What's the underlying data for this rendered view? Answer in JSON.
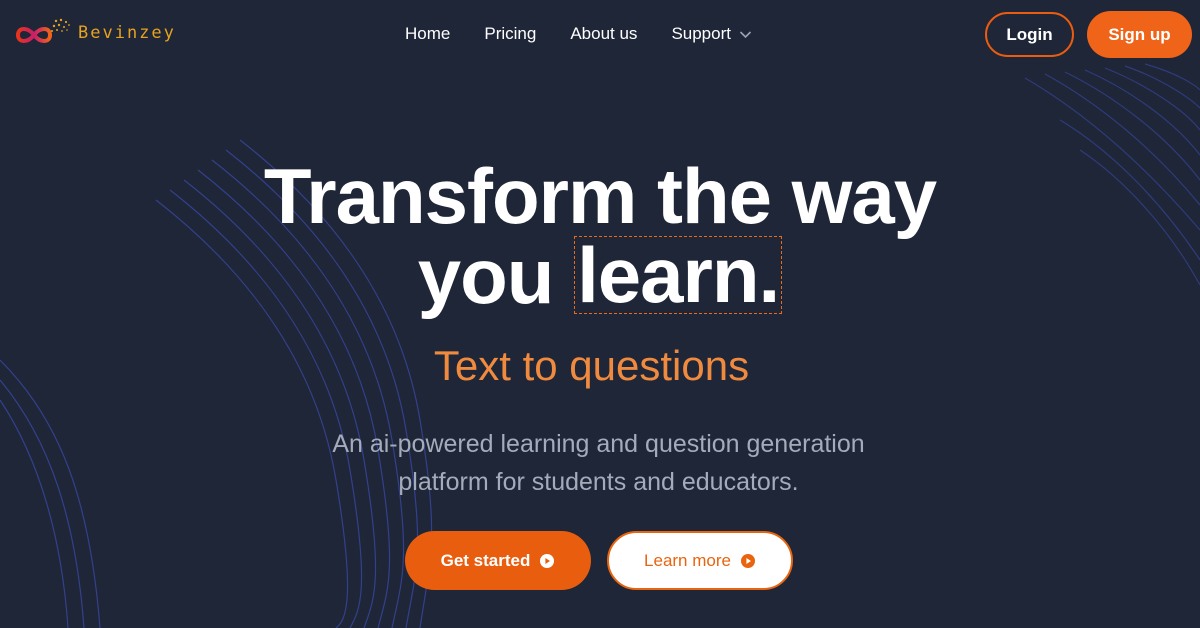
{
  "brand": {
    "name": "Bevinzey",
    "accent": "#f0641a",
    "logo_text_color": "#e8a21c"
  },
  "nav": {
    "items": [
      {
        "label": "Home"
      },
      {
        "label": "Pricing"
      },
      {
        "label": "About us"
      },
      {
        "label": "Support",
        "has_dropdown": true,
        "icon": "chevron-down-icon"
      }
    ]
  },
  "auth": {
    "login_label": "Login",
    "signup_label": "Sign up"
  },
  "hero": {
    "title_line1": "Transform the way",
    "title_line2_prefix": "you",
    "title_highlight": "learn.",
    "subtitle": "Text to questions",
    "description_line1": "An ai-powered learning and question generation",
    "description_line2": "platform for students and educators.",
    "cta_primary": "Get started",
    "cta_secondary": "Learn more",
    "cta_icon": "play-circle-icon"
  },
  "colors": {
    "background": "#1e2638",
    "subtitle": "#ef8a3e",
    "description": "#a4acbb",
    "wave_lines": "#3b4aa8"
  }
}
